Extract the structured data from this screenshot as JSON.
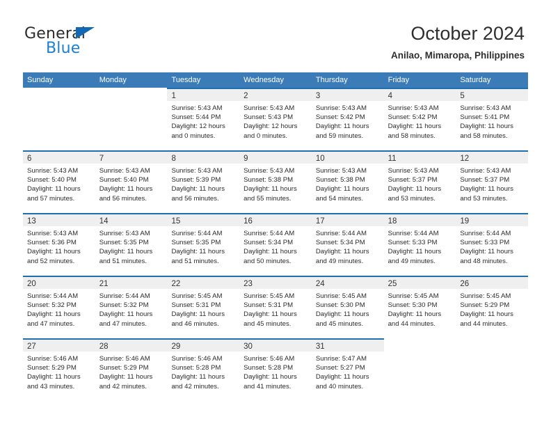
{
  "brand": {
    "word_one": "General",
    "word_two": "Blue",
    "triangle_icon": "triangle-icon",
    "accent_color": "#1268b3",
    "blue_text_color": "#1b7fd4"
  },
  "header": {
    "title": "October 2024",
    "subtitle": "Anilao, Mimaropa, Philippines"
  },
  "calendar": {
    "header_bg": "#3b7cb8",
    "row_rule_color": "#1f6ead",
    "daynum_band_bg": "#efefef",
    "weekdays": [
      "Sunday",
      "Monday",
      "Tuesday",
      "Wednesday",
      "Thursday",
      "Friday",
      "Saturday"
    ],
    "weeks": [
      [
        {
          "blank": true,
          "band": true
        },
        {
          "blank": true,
          "band": true
        },
        {
          "day": "1",
          "sunrise": "Sunrise: 5:43 AM",
          "sunset": "Sunset: 5:44 PM",
          "daylight_1": "Daylight: 12 hours",
          "daylight_2": "and 0 minutes."
        },
        {
          "day": "2",
          "sunrise": "Sunrise: 5:43 AM",
          "sunset": "Sunset: 5:43 PM",
          "daylight_1": "Daylight: 12 hours",
          "daylight_2": "and 0 minutes."
        },
        {
          "day": "3",
          "sunrise": "Sunrise: 5:43 AM",
          "sunset": "Sunset: 5:42 PM",
          "daylight_1": "Daylight: 11 hours",
          "daylight_2": "and 59 minutes."
        },
        {
          "day": "4",
          "sunrise": "Sunrise: 5:43 AM",
          "sunset": "Sunset: 5:42 PM",
          "daylight_1": "Daylight: 11 hours",
          "daylight_2": "and 58 minutes."
        },
        {
          "day": "5",
          "sunrise": "Sunrise: 5:43 AM",
          "sunset": "Sunset: 5:41 PM",
          "daylight_1": "Daylight: 11 hours",
          "daylight_2": "and 58 minutes."
        }
      ],
      [
        {
          "day": "6",
          "sunrise": "Sunrise: 5:43 AM",
          "sunset": "Sunset: 5:40 PM",
          "daylight_1": "Daylight: 11 hours",
          "daylight_2": "and 57 minutes."
        },
        {
          "day": "7",
          "sunrise": "Sunrise: 5:43 AM",
          "sunset": "Sunset: 5:40 PM",
          "daylight_1": "Daylight: 11 hours",
          "daylight_2": "and 56 minutes."
        },
        {
          "day": "8",
          "sunrise": "Sunrise: 5:43 AM",
          "sunset": "Sunset: 5:39 PM",
          "daylight_1": "Daylight: 11 hours",
          "daylight_2": "and 56 minutes."
        },
        {
          "day": "9",
          "sunrise": "Sunrise: 5:43 AM",
          "sunset": "Sunset: 5:38 PM",
          "daylight_1": "Daylight: 11 hours",
          "daylight_2": "and 55 minutes."
        },
        {
          "day": "10",
          "sunrise": "Sunrise: 5:43 AM",
          "sunset": "Sunset: 5:38 PM",
          "daylight_1": "Daylight: 11 hours",
          "daylight_2": "and 54 minutes."
        },
        {
          "day": "11",
          "sunrise": "Sunrise: 5:43 AM",
          "sunset": "Sunset: 5:37 PM",
          "daylight_1": "Daylight: 11 hours",
          "daylight_2": "and 53 minutes."
        },
        {
          "day": "12",
          "sunrise": "Sunrise: 5:43 AM",
          "sunset": "Sunset: 5:37 PM",
          "daylight_1": "Daylight: 11 hours",
          "daylight_2": "and 53 minutes."
        }
      ],
      [
        {
          "day": "13",
          "sunrise": "Sunrise: 5:43 AM",
          "sunset": "Sunset: 5:36 PM",
          "daylight_1": "Daylight: 11 hours",
          "daylight_2": "and 52 minutes."
        },
        {
          "day": "14",
          "sunrise": "Sunrise: 5:43 AM",
          "sunset": "Sunset: 5:35 PM",
          "daylight_1": "Daylight: 11 hours",
          "daylight_2": "and 51 minutes."
        },
        {
          "day": "15",
          "sunrise": "Sunrise: 5:44 AM",
          "sunset": "Sunset: 5:35 PM",
          "daylight_1": "Daylight: 11 hours",
          "daylight_2": "and 51 minutes."
        },
        {
          "day": "16",
          "sunrise": "Sunrise: 5:44 AM",
          "sunset": "Sunset: 5:34 PM",
          "daylight_1": "Daylight: 11 hours",
          "daylight_2": "and 50 minutes."
        },
        {
          "day": "17",
          "sunrise": "Sunrise: 5:44 AM",
          "sunset": "Sunset: 5:34 PM",
          "daylight_1": "Daylight: 11 hours",
          "daylight_2": "and 49 minutes."
        },
        {
          "day": "18",
          "sunrise": "Sunrise: 5:44 AM",
          "sunset": "Sunset: 5:33 PM",
          "daylight_1": "Daylight: 11 hours",
          "daylight_2": "and 49 minutes."
        },
        {
          "day": "19",
          "sunrise": "Sunrise: 5:44 AM",
          "sunset": "Sunset: 5:33 PM",
          "daylight_1": "Daylight: 11 hours",
          "daylight_2": "and 48 minutes."
        }
      ],
      [
        {
          "day": "20",
          "sunrise": "Sunrise: 5:44 AM",
          "sunset": "Sunset: 5:32 PM",
          "daylight_1": "Daylight: 11 hours",
          "daylight_2": "and 47 minutes."
        },
        {
          "day": "21",
          "sunrise": "Sunrise: 5:44 AM",
          "sunset": "Sunset: 5:32 PM",
          "daylight_1": "Daylight: 11 hours",
          "daylight_2": "and 47 minutes."
        },
        {
          "day": "22",
          "sunrise": "Sunrise: 5:45 AM",
          "sunset": "Sunset: 5:31 PM",
          "daylight_1": "Daylight: 11 hours",
          "daylight_2": "and 46 minutes."
        },
        {
          "day": "23",
          "sunrise": "Sunrise: 5:45 AM",
          "sunset": "Sunset: 5:31 PM",
          "daylight_1": "Daylight: 11 hours",
          "daylight_2": "and 45 minutes."
        },
        {
          "day": "24",
          "sunrise": "Sunrise: 5:45 AM",
          "sunset": "Sunset: 5:30 PM",
          "daylight_1": "Daylight: 11 hours",
          "daylight_2": "and 45 minutes."
        },
        {
          "day": "25",
          "sunrise": "Sunrise: 5:45 AM",
          "sunset": "Sunset: 5:30 PM",
          "daylight_1": "Daylight: 11 hours",
          "daylight_2": "and 44 minutes."
        },
        {
          "day": "26",
          "sunrise": "Sunrise: 5:45 AM",
          "sunset": "Sunset: 5:29 PM",
          "daylight_1": "Daylight: 11 hours",
          "daylight_2": "and 44 minutes."
        }
      ],
      [
        {
          "day": "27",
          "sunrise": "Sunrise: 5:46 AM",
          "sunset": "Sunset: 5:29 PM",
          "daylight_1": "Daylight: 11 hours",
          "daylight_2": "and 43 minutes."
        },
        {
          "day": "28",
          "sunrise": "Sunrise: 5:46 AM",
          "sunset": "Sunset: 5:29 PM",
          "daylight_1": "Daylight: 11 hours",
          "daylight_2": "and 42 minutes."
        },
        {
          "day": "29",
          "sunrise": "Sunrise: 5:46 AM",
          "sunset": "Sunset: 5:28 PM",
          "daylight_1": "Daylight: 11 hours",
          "daylight_2": "and 42 minutes."
        },
        {
          "day": "30",
          "sunrise": "Sunrise: 5:46 AM",
          "sunset": "Sunset: 5:28 PM",
          "daylight_1": "Daylight: 11 hours",
          "daylight_2": "and 41 minutes."
        },
        {
          "day": "31",
          "sunrise": "Sunrise: 5:47 AM",
          "sunset": "Sunset: 5:27 PM",
          "daylight_1": "Daylight: 11 hours",
          "daylight_2": "and 40 minutes."
        },
        {
          "blank": true,
          "band": false
        },
        {
          "blank": true,
          "band": false
        }
      ]
    ]
  }
}
